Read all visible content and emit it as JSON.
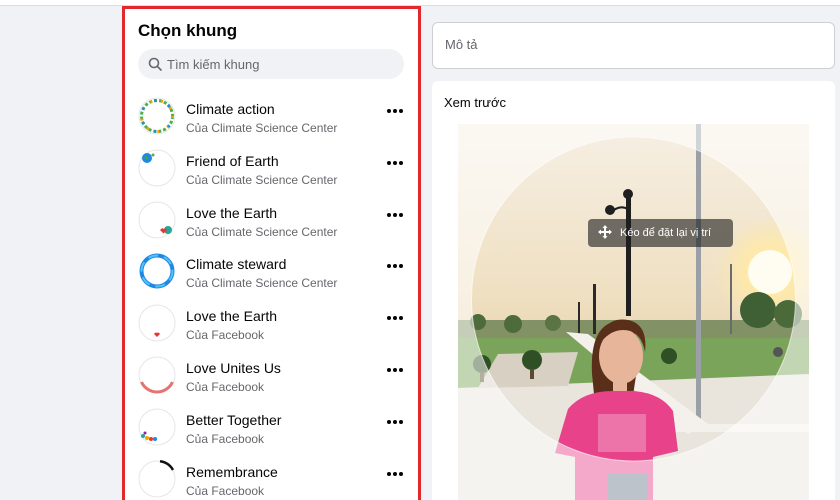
{
  "panel": {
    "title": "Chọn khung",
    "search_placeholder": "Tìm kiếm khung"
  },
  "frames": [
    {
      "name": "Climate action",
      "owner": "Của Climate Science Center",
      "thumb": "climate-action-ring"
    },
    {
      "name": "Friend of Earth",
      "owner": "Của Climate Science Center",
      "thumb": "earth-globe-corner"
    },
    {
      "name": "Love the Earth",
      "owner": "Của Climate Science Center",
      "thumb": "earth-heart-corner"
    },
    {
      "name": "Climate steward",
      "owner": "Của Climate Science Center",
      "thumb": "blue-swirl-ring"
    },
    {
      "name": "Love the Earth",
      "owner": "Của Facebook",
      "thumb": "heart-top"
    },
    {
      "name": "Love Unites Us",
      "owner": "Của Facebook",
      "thumb": "red-arc-bottom"
    },
    {
      "name": "Better Together",
      "owner": "Của Facebook",
      "thumb": "colorful-leaves-corner"
    },
    {
      "name": "Remembrance",
      "owner": "Của Facebook",
      "thumb": "black-arc-top-right"
    }
  ],
  "description": {
    "placeholder": "Mô tả"
  },
  "preview": {
    "title": "Xem trước",
    "drag_hint": "Kéo để đặt lại vị trí"
  },
  "colors": {
    "highlight_border": "#e0282d",
    "background": "#f0f2f5",
    "secondary_text": "#65676b"
  }
}
